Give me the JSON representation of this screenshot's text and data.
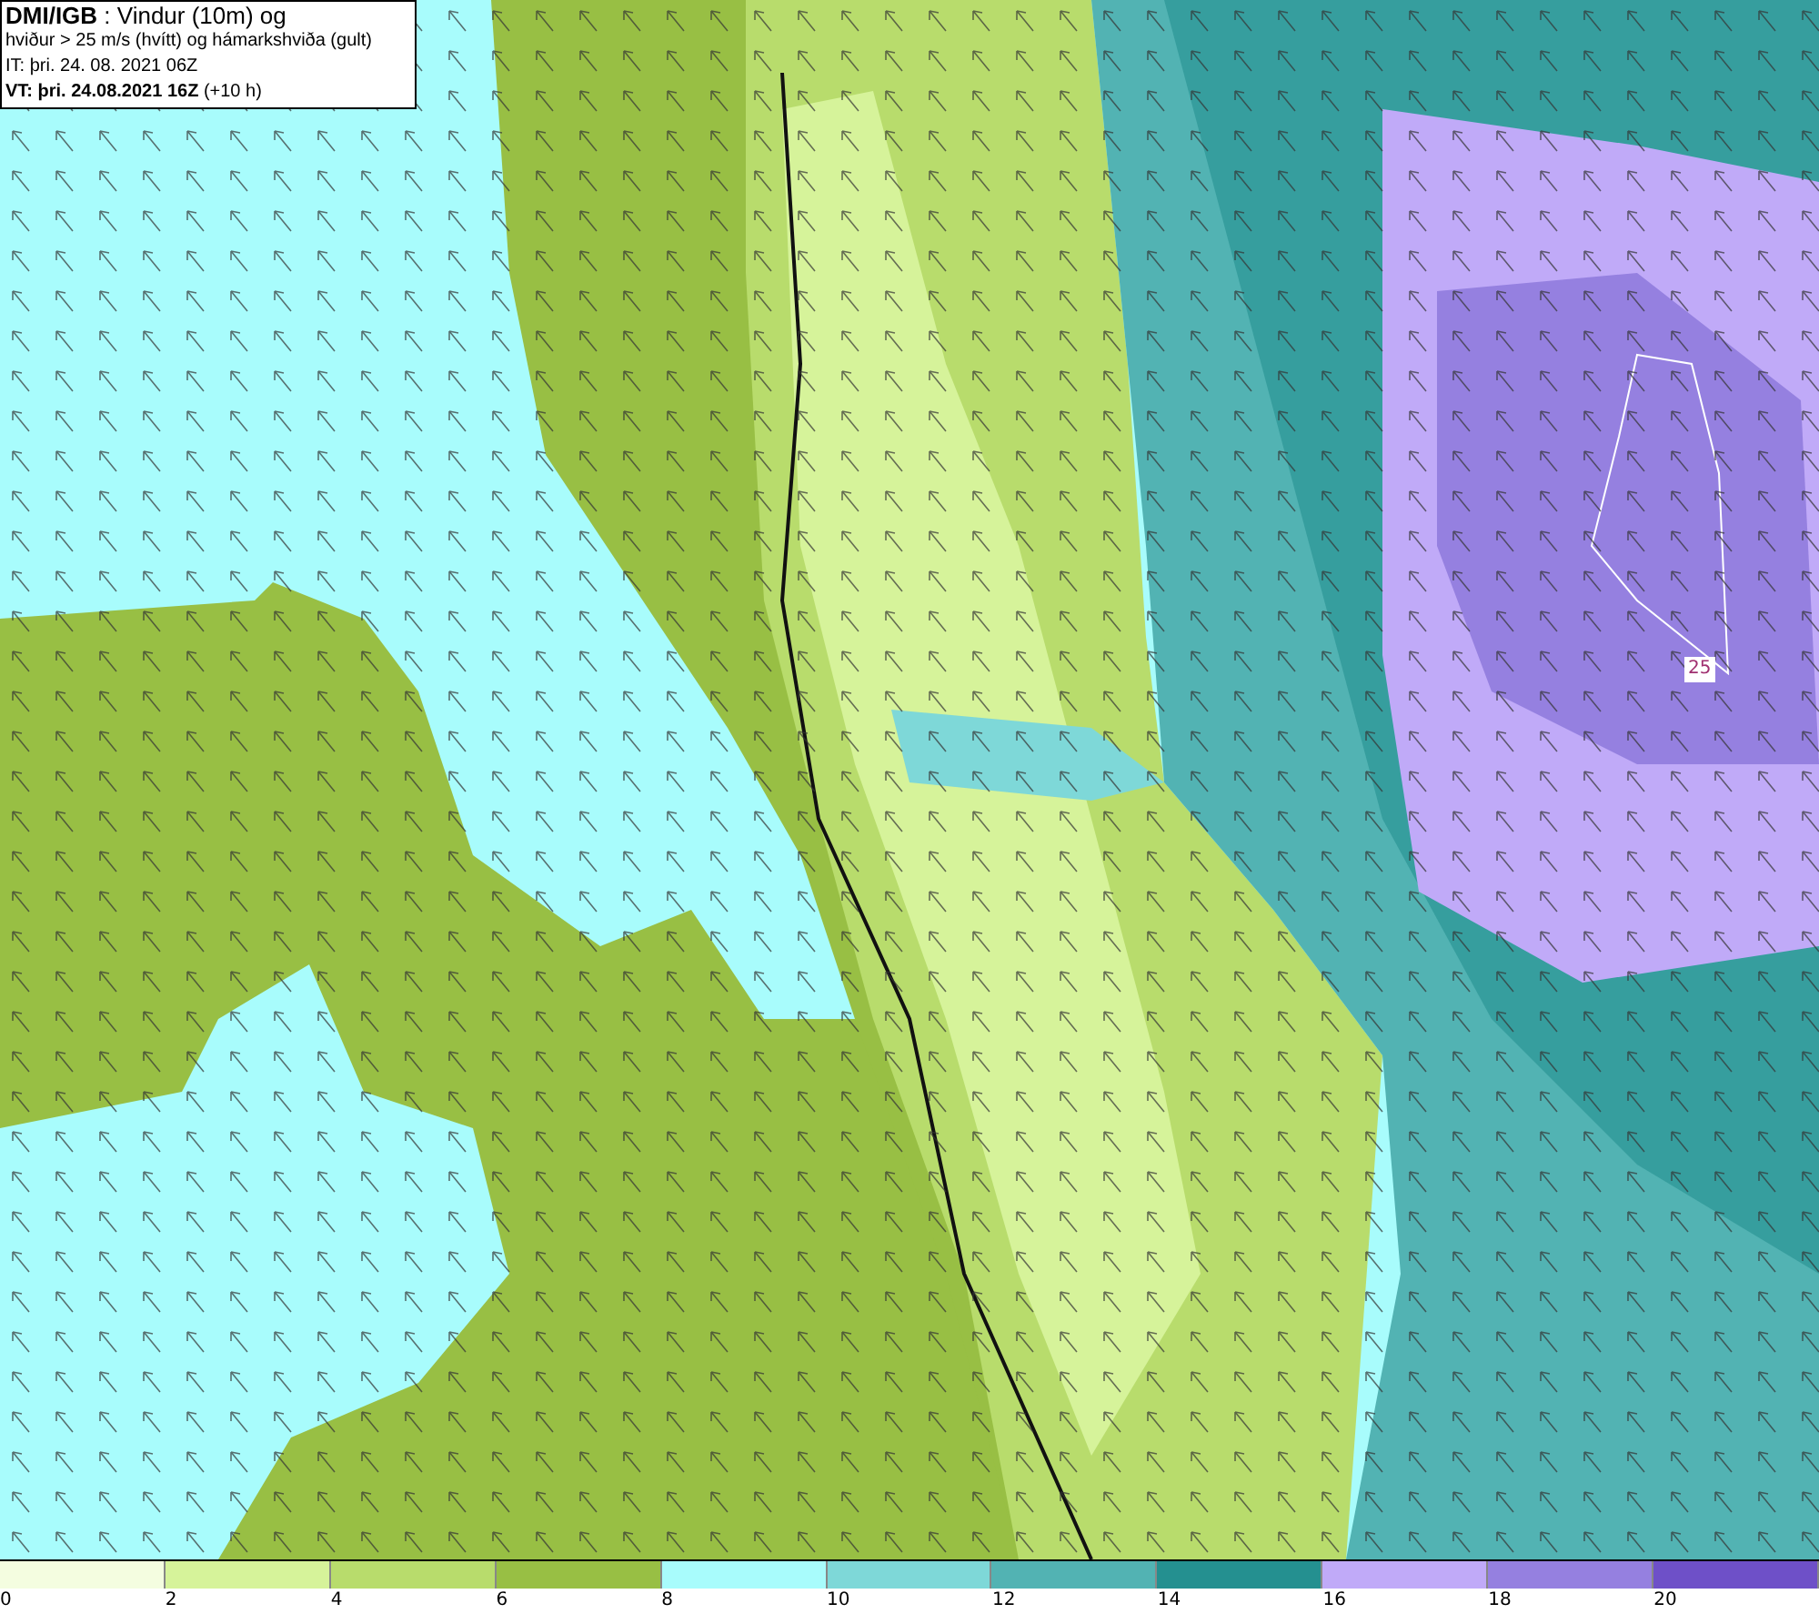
{
  "header": {
    "lines": [
      "**DMI/IGB** : Vindur (10m) og",
      "hviður > 25 m/s (hvítt) og hámarkshviða (gult)",
      "IT: þri. 24. 08. 2021 06Z",
      "**VT: þri. 24.08.2021 16Z** (+10 h)"
    ]
  },
  "map": {
    "contour_label": "25"
  },
  "legend": [
    {
      "label": "0",
      "color": "#f4fde0"
    },
    {
      "label": "2",
      "color": "#d6f39a"
    },
    {
      "label": "4",
      "color": "#b8dc6c"
    },
    {
      "label": "6",
      "color": "#98bf44"
    },
    {
      "label": "8",
      "color": "#a8fcfc"
    },
    {
      "label": "10",
      "color": "#7ed8d8"
    },
    {
      "label": "12",
      "color": "#52b3b3"
    },
    {
      "label": "14",
      "color": "#249090"
    },
    {
      "label": "16",
      "color": "#c0aaf8"
    },
    {
      "label": "18",
      "color": "#9580e0"
    },
    {
      "label": "20",
      "color": "#6e50c8"
    }
  ]
}
